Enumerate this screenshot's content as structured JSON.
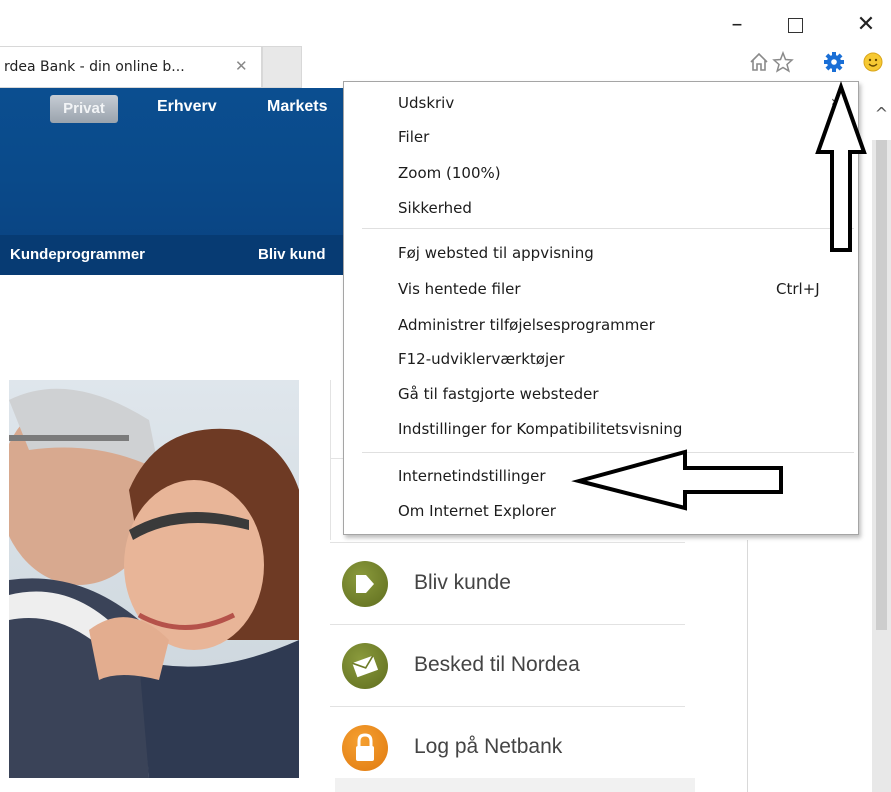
{
  "window": {
    "minimize": "–",
    "close": "✕"
  },
  "tab": {
    "title": "rdea Bank - din online b...",
    "close": "✕"
  },
  "toolbar": {
    "icons": [
      "home-icon",
      "star-icon",
      "gear-icon",
      "smiley-icon"
    ],
    "gear_color": "#1a6fd6"
  },
  "site": {
    "nav_top": [
      "Privat",
      "Erhverv",
      "Markets"
    ],
    "subnav": [
      "Kundeprogrammer",
      "Bliv kund"
    ],
    "header_color": "#0a4a8a",
    "actions": [
      {
        "label": "Bliv kunde",
        "icon": "arrow-right-icon",
        "color": "#6d7b26"
      },
      {
        "label": "Besked til Nordea",
        "icon": "envelope-icon",
        "color": "#6d7b26"
      },
      {
        "label": "Log på Netbank",
        "icon": "padlock-icon",
        "color": "#ef8a1a"
      }
    ]
  },
  "menu": {
    "items": [
      {
        "label": "Udskriv",
        "submenu": true
      },
      {
        "label": "Filer",
        "submenu": true
      },
      {
        "label": "Zoom (100%)",
        "submenu": true
      },
      {
        "label": "Sikkerhed",
        "submenu": true
      },
      {
        "label": "Føj websted til appvisning"
      },
      {
        "label": "Vis hentede filer",
        "shortcut": "Ctrl+J"
      },
      {
        "label": "Administrer tilføjelsesprogrammer"
      },
      {
        "label": "F12-udviklerværktøjer"
      },
      {
        "label": "Gå til fastgjorte websteder"
      },
      {
        "label": "Indstillinger for Kompatibilitetsvisning"
      },
      {
        "label": "Internetindstillinger"
      },
      {
        "label": "Om Internet Explorer"
      }
    ],
    "submenu_arrow": "›"
  },
  "annotations": {
    "arrow_color": "#000000"
  }
}
